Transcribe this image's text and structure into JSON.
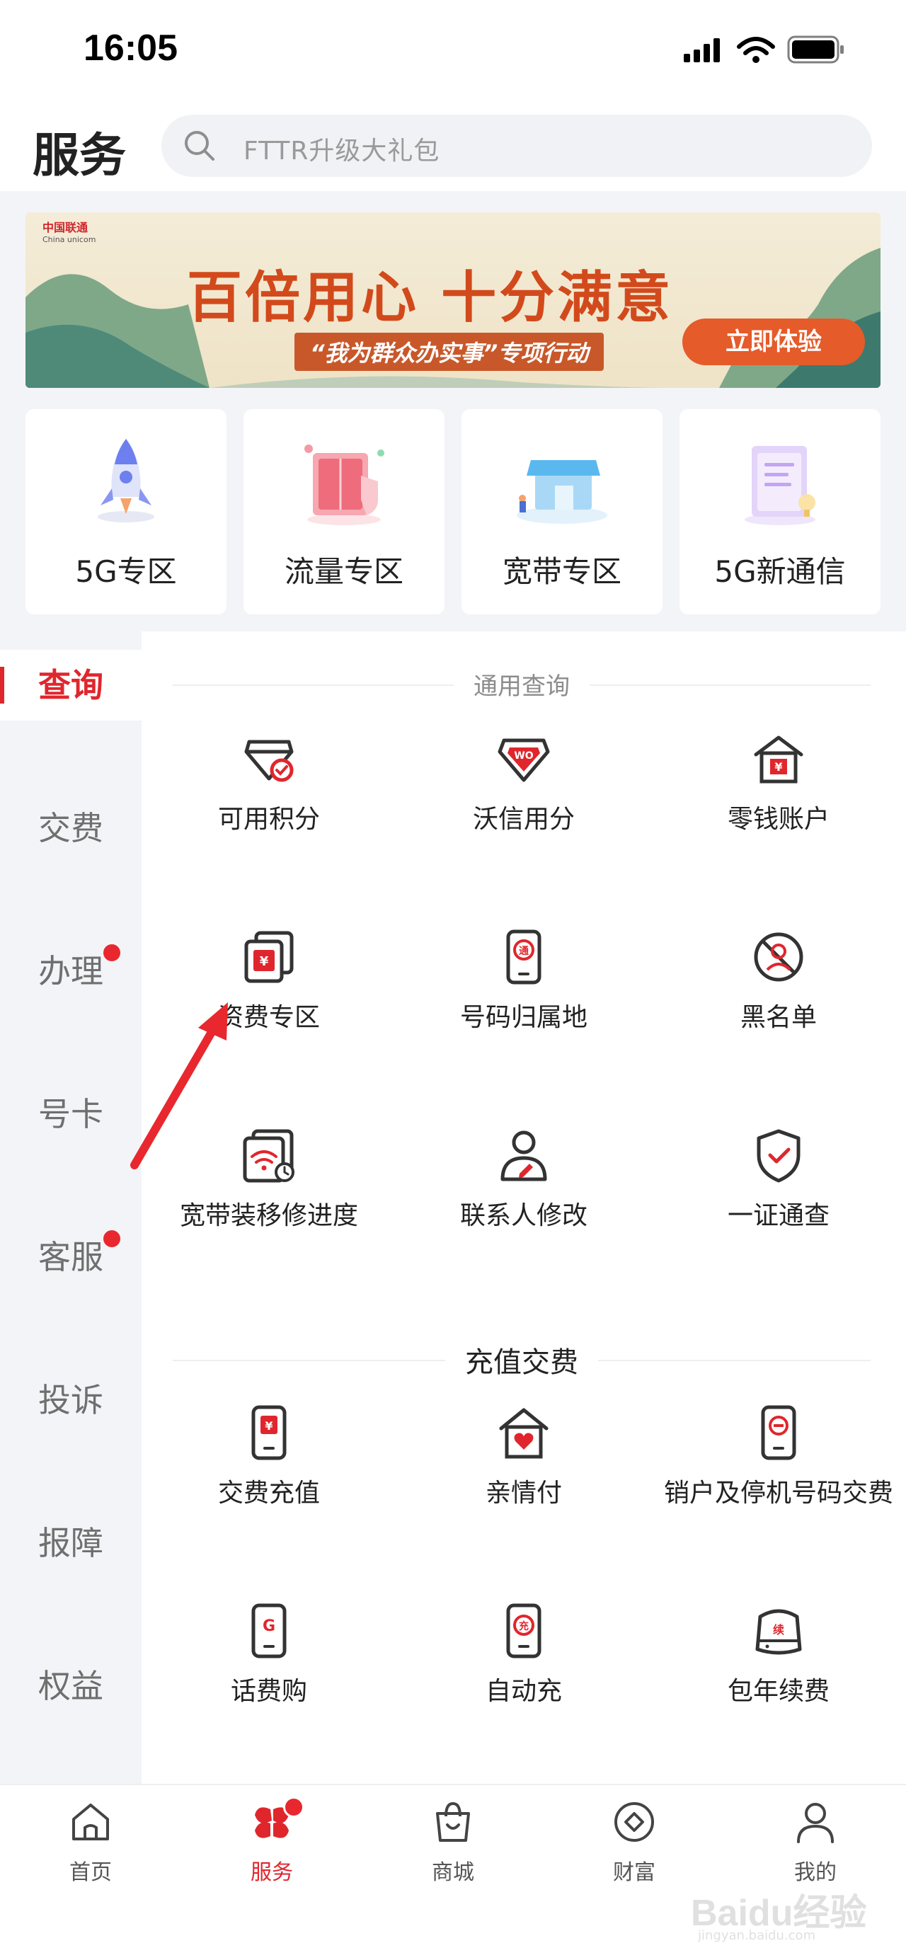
{
  "status_bar": {
    "time": "16:05"
  },
  "header": {
    "title": "服务",
    "search_placeholder": "FTTR升级大礼包"
  },
  "banner": {
    "logo": "中国联通",
    "logo_en": "China unicom",
    "slogan": "百倍用心 十分满意",
    "subtitle": "“我为群众办实事”专项行动",
    "cta": "立即体验"
  },
  "zones": [
    {
      "label": "5G专区",
      "icon": "rocket-icon"
    },
    {
      "label": "流量专区",
      "icon": "data-box-icon"
    },
    {
      "label": "宽带专区",
      "icon": "broadband-store-icon"
    },
    {
      "label": "5G新通信",
      "icon": "clipboard-icon"
    }
  ],
  "sidebar": {
    "items": [
      {
        "label": "查询",
        "active": true,
        "dot": false
      },
      {
        "label": "交费",
        "active": false,
        "dot": false
      },
      {
        "label": "办理",
        "active": false,
        "dot": true
      },
      {
        "label": "号卡",
        "active": false,
        "dot": false
      },
      {
        "label": "客服",
        "active": false,
        "dot": true
      },
      {
        "label": "投诉",
        "active": false,
        "dot": false
      },
      {
        "label": "报障",
        "active": false,
        "dot": false
      },
      {
        "label": "权益",
        "active": false,
        "dot": false
      }
    ]
  },
  "sections": [
    {
      "title": "通用查询",
      "items": [
        {
          "label": "可用积分",
          "icon": "points-icon"
        },
        {
          "label": "沃信用分",
          "icon": "wo-credit-icon"
        },
        {
          "label": "零钱账户",
          "icon": "wallet-house-icon"
        },
        {
          "label": "资费专区",
          "icon": "tariff-cards-icon"
        },
        {
          "label": "号码归属地",
          "icon": "phone-location-icon"
        },
        {
          "label": "黑名单",
          "icon": "blacklist-icon"
        },
        {
          "label": "宽带装移修进度",
          "icon": "broadband-progress-icon"
        },
        {
          "label": "联系人修改",
          "icon": "contact-edit-icon"
        },
        {
          "label": "一证通查",
          "icon": "shield-check-icon"
        }
      ]
    },
    {
      "title": "充值交费",
      "items": [
        {
          "label": "交费充值",
          "icon": "phone-recharge-icon"
        },
        {
          "label": "亲情付",
          "icon": "family-pay-icon"
        },
        {
          "label": "销户及停机号码交费",
          "icon": "phone-stop-icon"
        },
        {
          "label": "话费购",
          "icon": "phone-g-icon"
        },
        {
          "label": "自动充",
          "icon": "auto-recharge-icon"
        },
        {
          "label": "包年续费",
          "icon": "annual-renew-icon"
        }
      ]
    }
  ],
  "bottom_nav": [
    {
      "label": "首页",
      "icon": "home-icon",
      "active": false
    },
    {
      "label": "服务",
      "icon": "service-icon",
      "active": true
    },
    {
      "label": "商城",
      "icon": "shopping-bag-icon",
      "active": false
    },
    {
      "label": "财富",
      "icon": "coin-icon",
      "active": false
    },
    {
      "label": "我的",
      "icon": "profile-icon",
      "active": false
    }
  ],
  "watermark": {
    "text": "Baidu经验",
    "sub": "jingyan.baidu.com"
  },
  "colors": {
    "accent": "#e0262d",
    "icon_red": "#e0262d",
    "icon_dark": "#333333",
    "gray_bg": "#f3f4f7"
  }
}
